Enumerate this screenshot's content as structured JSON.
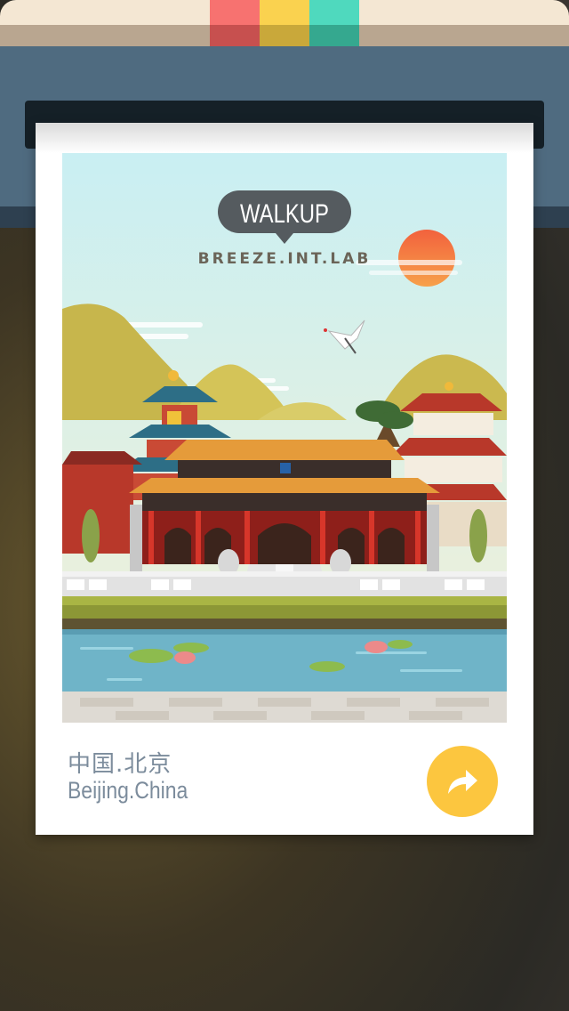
{
  "poster": {
    "brand": "WALKUP",
    "subtitle": "BREEZE.INT.LAB"
  },
  "location": {
    "name_cn": "中国.北京",
    "name_en": "Beijing.China"
  },
  "swatches": [
    "#f77270",
    "#fad24f",
    "#4fd9be"
  ],
  "share_icon": "share-arrow-icon",
  "colors": {
    "accent": "#fcc63f",
    "location_text": "#7c8c9c"
  }
}
